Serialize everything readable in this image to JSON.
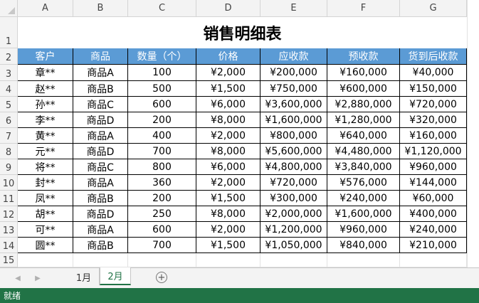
{
  "columns": [
    "A",
    "B",
    "C",
    "D",
    "E",
    "F",
    "G"
  ],
  "rows": [
    "1",
    "2",
    "3",
    "4",
    "5",
    "6",
    "7",
    "8",
    "9",
    "10",
    "11",
    "12",
    "13",
    "14",
    "15"
  ],
  "title": "销售明细表",
  "table": {
    "headers": [
      "客户",
      "商品",
      "数量（个）",
      "价格",
      "应收款",
      "预收款",
      "货到后收款"
    ],
    "rows": [
      [
        "章**",
        "商品A",
        "100",
        "¥2,000",
        "¥200,000",
        "¥160,000",
        "¥40,000"
      ],
      [
        "赵**",
        "商品B",
        "500",
        "¥1,500",
        "¥750,000",
        "¥600,000",
        "¥150,000"
      ],
      [
        "孙**",
        "商品C",
        "600",
        "¥6,000",
        "¥3,600,000",
        "¥2,880,000",
        "¥720,000"
      ],
      [
        "李**",
        "商品D",
        "200",
        "¥8,000",
        "¥1,600,000",
        "¥1,280,000",
        "¥320,000"
      ],
      [
        "黄**",
        "商品A",
        "400",
        "¥2,000",
        "¥800,000",
        "¥640,000",
        "¥160,000"
      ],
      [
        "元**",
        "商品D",
        "700",
        "¥8,000",
        "¥5,600,000",
        "¥4,480,000",
        "¥1,120,000"
      ],
      [
        "将**",
        "商品C",
        "800",
        "¥6,000",
        "¥4,800,000",
        "¥3,840,000",
        "¥960,000"
      ],
      [
        "封**",
        "商品A",
        "360",
        "¥2,000",
        "¥720,000",
        "¥576,000",
        "¥144,000"
      ],
      [
        "凤**",
        "商品B",
        "200",
        "¥1,500",
        "¥300,000",
        "¥240,000",
        "¥60,000"
      ],
      [
        "胡**",
        "商品D",
        "250",
        "¥8,000",
        "¥2,000,000",
        "¥1,600,000",
        "¥400,000"
      ],
      [
        "可**",
        "商品A",
        "600",
        "¥2,000",
        "¥1,200,000",
        "¥960,000",
        "¥240,000"
      ],
      [
        "圆**",
        "商品B",
        "700",
        "¥1,500",
        "¥1,050,000",
        "¥840,000",
        "¥210,000"
      ]
    ]
  },
  "sheet_tabs": [
    "1月",
    "2月"
  ],
  "active_tab": "2月",
  "nav_icons": [
    "scroll-left-icon",
    "scroll-right-icon"
  ],
  "add_sheet_icon": "plus-circle-icon",
  "status_text": "就绪",
  "colors": {
    "header_fill": "#5b9bd5",
    "header_text": "#ffffff",
    "status_bar": "#217346",
    "active_tab_text": "#217346"
  }
}
